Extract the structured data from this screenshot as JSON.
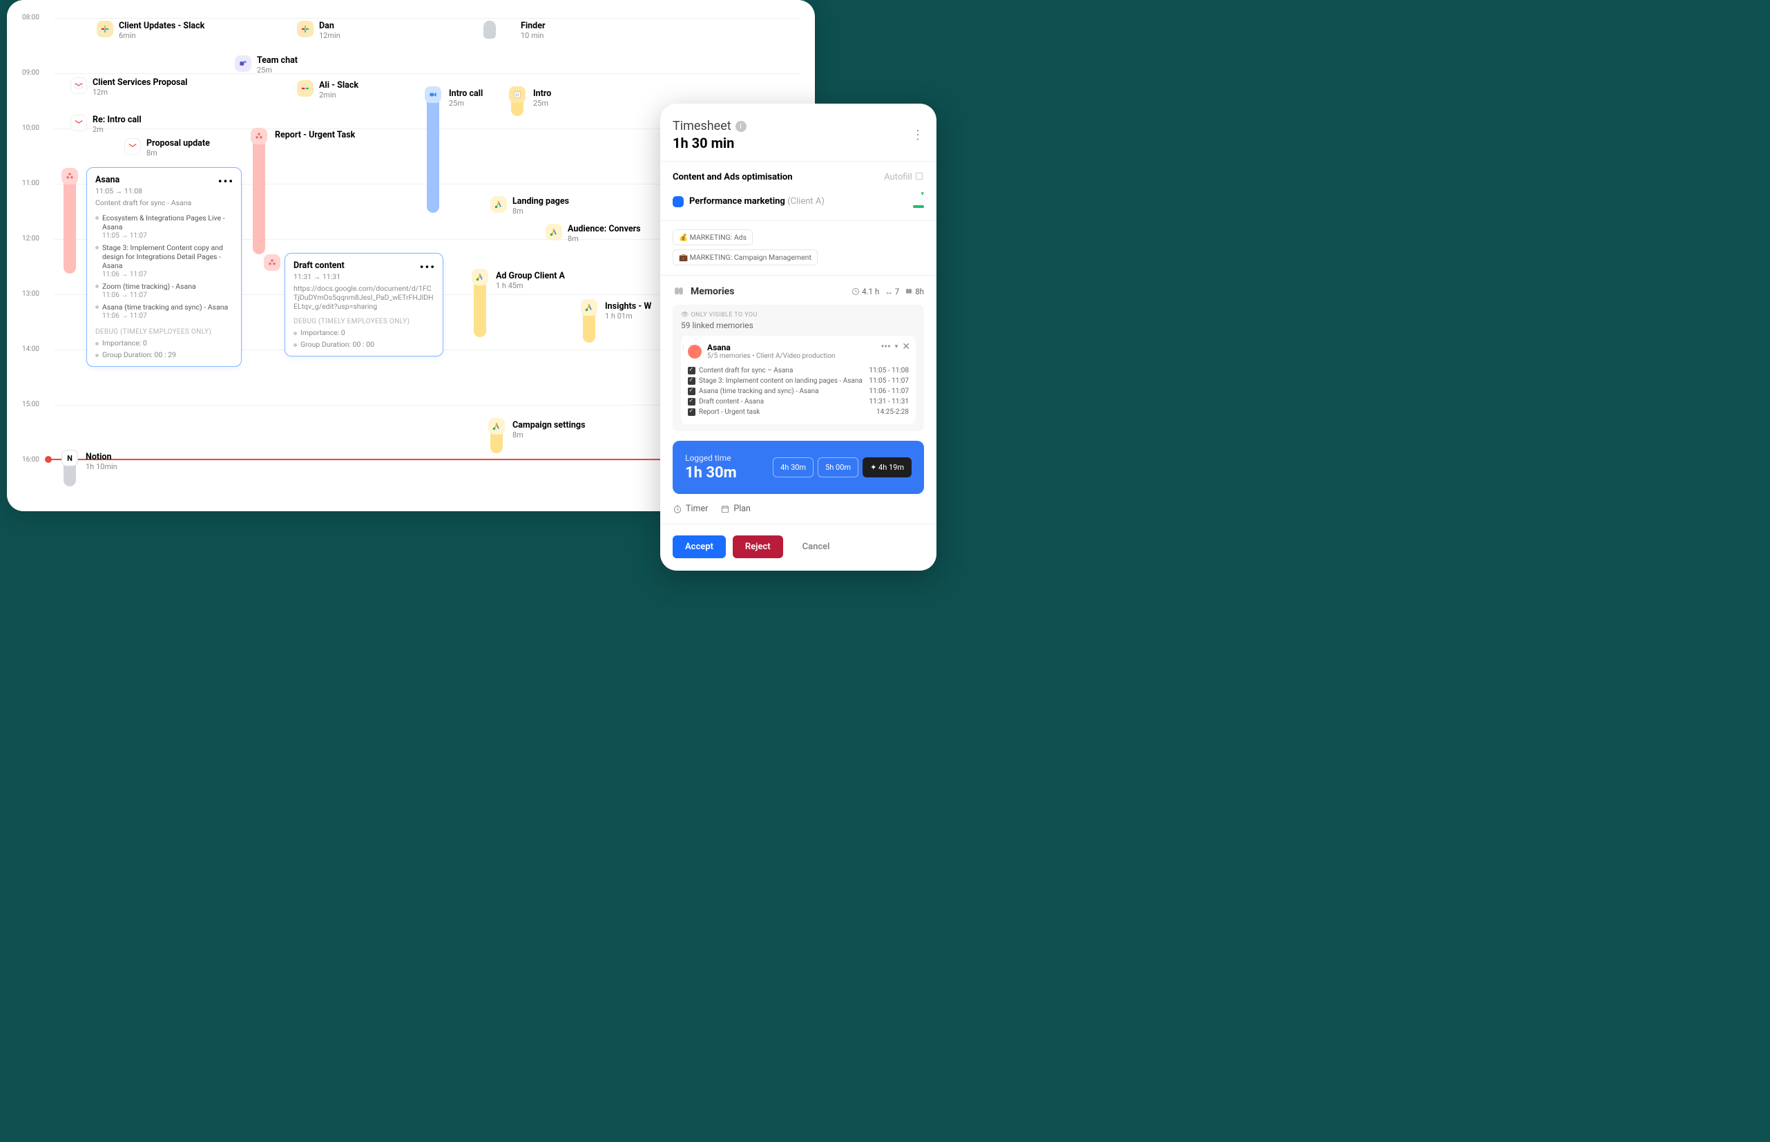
{
  "timeline": {
    "hours": [
      "08:00",
      "09:00",
      "10:00",
      "11:00",
      "12:00",
      "13:00",
      "14:00",
      "15:00",
      "16:00"
    ],
    "events": {
      "slack1": {
        "title": "Client Updates - Slack",
        "sub": "6min"
      },
      "dan": {
        "title": "Dan",
        "sub": "12min"
      },
      "finder": {
        "title": "Finder",
        "sub": "10 min"
      },
      "gmail1": {
        "title": "Client Services Proposal",
        "sub": "12m"
      },
      "teams": {
        "title": "Team chat",
        "sub": "25m"
      },
      "ali": {
        "title": "Ali - Slack",
        "sub": "2min"
      },
      "zoom": {
        "title": "Intro call",
        "sub": "25m"
      },
      "cal": {
        "title": "Intro",
        "sub": "25m"
      },
      "reintro": {
        "title": "Re: Intro call",
        "sub": "2m"
      },
      "report": {
        "title": "Report - Urgent Task",
        "sub": ""
      },
      "proposal": {
        "title": "Proposal update",
        "sub": "8m"
      },
      "landing": {
        "title": "Landing pages",
        "sub": "8m"
      },
      "audience": {
        "title": "Audience: Convers",
        "sub": "8m"
      },
      "adgroup": {
        "title": "Ad Group Client A",
        "sub": "1 h 45m"
      },
      "insights": {
        "title": "Insights - W",
        "sub": "1 h 01m"
      },
      "campaign": {
        "title": "Campaign settings",
        "sub": "8m"
      },
      "notion": {
        "title": "Notion",
        "sub": "1h 10min"
      }
    },
    "card1": {
      "title": "Asana",
      "time": "11:05 → 11:08",
      "sub": "Content draft for sync - Asana",
      "items": [
        {
          "t": "Ecosystem & Integrations Pages Live - Asana",
          "r": "11:05 → 11:07"
        },
        {
          "t": "Stage 3: Implement Content copy and design for Integrations Detail Pages - Asana",
          "r": "11:06 → 11:07"
        },
        {
          "t": "Zoom (time tracking) - Asana",
          "r": "11:06 → 11:07"
        },
        {
          "t": "Asana (time tracking and sync) - Asana",
          "r": "11:06 → 11:07"
        }
      ],
      "debug": "DEBUG (TIMELY EMPLOYEES ONLY)",
      "importance": "Importance: 0",
      "duration": "Group Duration: 00 : 29"
    },
    "card2": {
      "title": "Draft content",
      "time": "11:31 → 11:31",
      "url": "https://docs.google.com/document/d/1FCTjDuDYmOs5qqnm8JesI_PaD_wETrFHJlDHELtqv_g/edit?usp=sharing",
      "debug": "DEBUG (TIMELY EMPLOYEES ONLY)",
      "importance": "Importance: 0",
      "duration": "Group Duration: 00 : 00"
    }
  },
  "panel": {
    "title": "Timesheet",
    "duration": "1h 30 min",
    "section": "Content and Ads optimisation",
    "autofill": "Autofill",
    "project": {
      "name": "Performance marketing",
      "client": "(Client A)"
    },
    "tags": [
      "💰  MARKETING: Ads",
      "💼  MARKETING: Campaign Management"
    ],
    "memories": {
      "label": "Memories",
      "total_h": "4.1 h",
      "count": "7",
      "day_h": "8h",
      "visible": "ONLY VISIBLE TO YOU",
      "linked": "59 linked memories",
      "app": {
        "name": "Asana",
        "sub": "5/5 memories • Client A/Video production"
      },
      "items": [
        {
          "t": "Content draft for sync – Asana",
          "r": "11:05 - 11:08"
        },
        {
          "t": "Stage 3: Implement content on landing pages  - Asana",
          "r": "11:05 - 11:07"
        },
        {
          "t": "Asana (time tracking and sync) - Asana",
          "r": "11:06 - 11:07"
        },
        {
          "t": "Draft content - Asana",
          "r": "11:31 - 11:31"
        },
        {
          "t": "Report - Urgent task",
          "r": "14:25-2:28"
        }
      ]
    },
    "logged": {
      "label": "Logged time",
      "value": "1h  30m",
      "opts": [
        "4h 30m",
        "5h 00m",
        "4h 19m"
      ]
    },
    "timer": "Timer",
    "plan": "Plan",
    "accept": "Accept",
    "reject": "Reject",
    "cancel": "Cancel"
  }
}
